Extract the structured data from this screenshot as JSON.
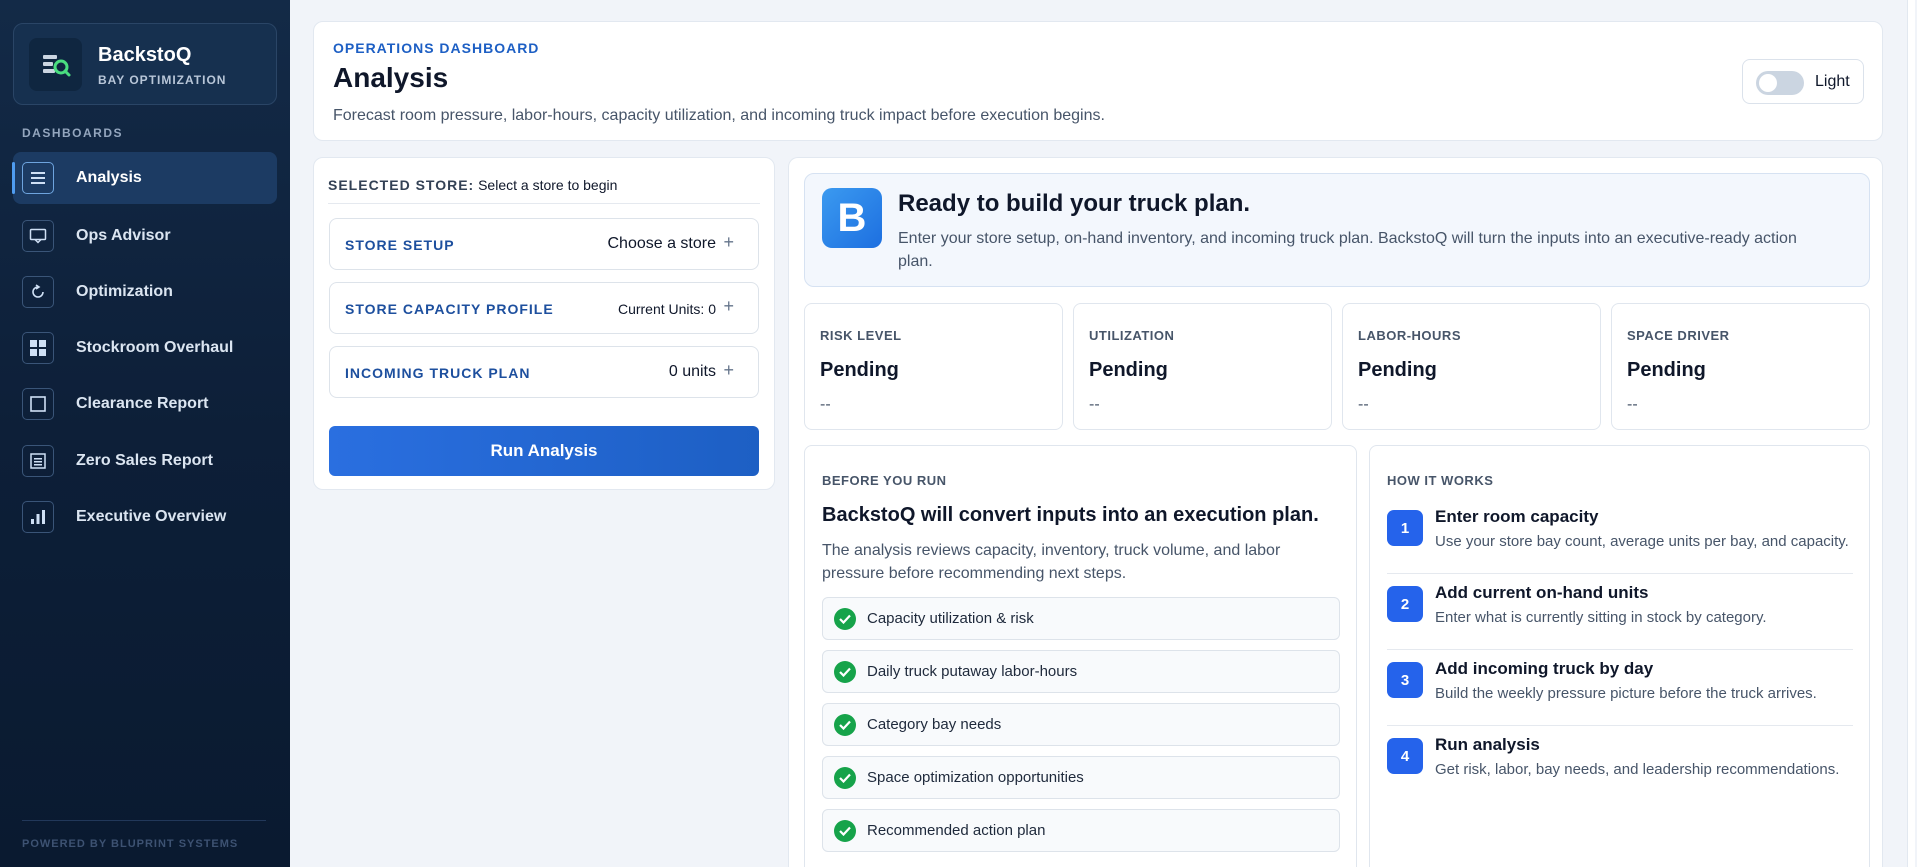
{
  "brand": {
    "name": "BackstoQ",
    "subtitle": "BAY OPTIMIZATION"
  },
  "sidebar": {
    "heading": "DASHBOARDS",
    "items": [
      {
        "label": "Analysis",
        "icon": "menu-icon",
        "active": true
      },
      {
        "label": "Ops Advisor",
        "icon": "chat-icon"
      },
      {
        "label": "Optimization",
        "icon": "refresh-icon"
      },
      {
        "label": "Stockroom Overhaul",
        "icon": "grid-icon"
      },
      {
        "label": "Clearance Report",
        "icon": "square-icon"
      },
      {
        "label": "Zero Sales Report",
        "icon": "list-icon"
      },
      {
        "label": "Executive Overview",
        "icon": "bar-chart-icon"
      }
    ],
    "footer": "POWERED BY BLUPRINT SYSTEMS"
  },
  "header": {
    "eyebrow": "OPERATIONS DASHBOARD",
    "title": "Analysis",
    "subtitle": "Forecast room pressure, labor-hours, capacity utilization, and incoming truck impact before execution begins.",
    "theme_label": "Light"
  },
  "store_panel": {
    "selected_key": "SELECTED STORE:",
    "selected_value": "Select a store to begin",
    "rows": [
      {
        "label": "STORE SETUP",
        "value": "Choose a store"
      },
      {
        "label": "STORE CAPACITY PROFILE",
        "value": "Current Units: 0"
      },
      {
        "label": "INCOMING TRUCK PLAN",
        "value": "0 units"
      }
    ],
    "run_label": "Run Analysis"
  },
  "hero": {
    "logo_letter": "B",
    "title": "Ready to build your truck plan.",
    "text": "Enter your store setup, on-hand inventory, and incoming truck plan. BackstoQ will turn the inputs into an executive-ready action plan."
  },
  "metrics": [
    {
      "label": "RISK LEVEL",
      "value": "Pending",
      "sub": "--"
    },
    {
      "label": "UTILIZATION",
      "value": "Pending",
      "sub": "--"
    },
    {
      "label": "LABOR-HOURS",
      "value": "Pending",
      "sub": "--"
    },
    {
      "label": "SPACE DRIVER",
      "value": "Pending",
      "sub": "--"
    }
  ],
  "before": {
    "eyebrow": "BEFORE YOU RUN",
    "title": "BackstoQ will convert inputs into an execution plan.",
    "text": "The analysis reviews capacity, inventory, truck volume, and labor pressure before recommending next steps.",
    "checks": [
      "Capacity utilization & risk",
      "Daily truck putaway labor-hours",
      "Category bay needs",
      "Space optimization opportunities",
      "Recommended action plan"
    ]
  },
  "how": {
    "eyebrow": "HOW IT WORKS",
    "steps": [
      {
        "num": "1",
        "title": "Enter room capacity",
        "desc": "Use your store bay count, average units per bay, and capacity."
      },
      {
        "num": "2",
        "title": "Add current on-hand units",
        "desc": "Enter what is currently sitting in stock by category."
      },
      {
        "num": "3",
        "title": "Add incoming truck by day",
        "desc": "Build the weekly pressure picture before the truck arrives."
      },
      {
        "num": "4",
        "title": "Run analysis",
        "desc": "Get risk, labor, bay needs, and leadership recommendations."
      }
    ]
  },
  "colors": {
    "accent": "#1d5fc4",
    "sidebar": "#0d1f38",
    "success": "#16a34a",
    "step": "#2563eb"
  }
}
